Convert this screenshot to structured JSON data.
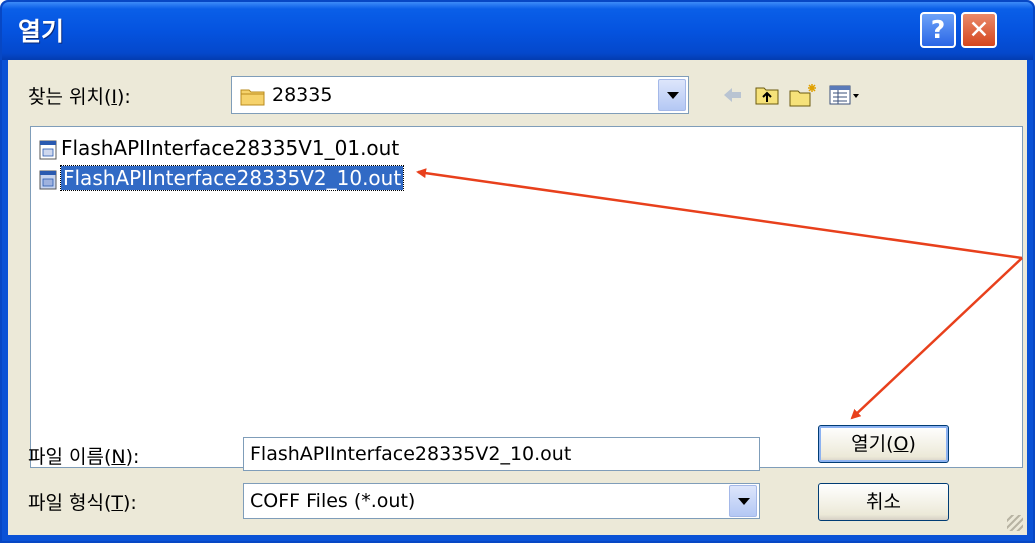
{
  "window": {
    "title": "열기",
    "help_label": "?",
    "close_label": "✕"
  },
  "look_in": {
    "label_prefix": "찾는 위치(",
    "label_key": "I",
    "label_suffix": "):",
    "value": "28335"
  },
  "toolbar": {
    "icons": [
      "back-icon",
      "up-folder-icon",
      "new-folder-icon",
      "view-menu-icon"
    ]
  },
  "files": [
    {
      "name": "FlashAPIInterface28335V1_01.out",
      "selected": false
    },
    {
      "name": "FlashAPIInterface28335V2_10.out",
      "selected": true
    }
  ],
  "filename": {
    "label_prefix": "파일 이름(",
    "label_key": "N",
    "label_suffix": "):",
    "value": "FlashAPIInterface28335V2_10.out"
  },
  "filetype": {
    "label_prefix": "파일 형식(",
    "label_key": "T",
    "label_suffix": "):",
    "value": "COFF Files (*.out)"
  },
  "buttons": {
    "open_prefix": "열기(",
    "open_key": "O",
    "open_suffix": ")",
    "cancel": "취소"
  },
  "colors": {
    "titlebar": "#0553df",
    "selection": "#316ac5",
    "annotation_arrow": "#e8401c"
  }
}
